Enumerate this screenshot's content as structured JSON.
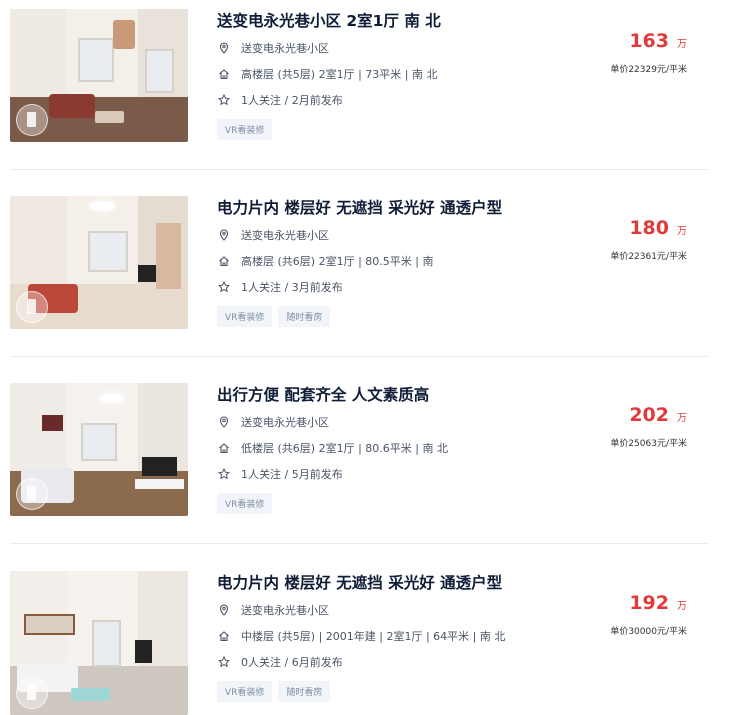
{
  "listings": [
    {
      "title": "送变电永光巷小区 2室1厅 南 北",
      "community": "送变电永光巷小区",
      "info": "高楼层 (共5层) 2室1厅 | 73平米 | 南 北",
      "follow": "1人关注 / 2月前发布",
      "tags": [
        "VR看装修"
      ],
      "price": "163",
      "price_unit": "万",
      "unit_price": "单价22329元/平米"
    },
    {
      "title": "电力片内 楼层好 无遮挡 采光好 通透户型",
      "community": "送变电永光巷小区",
      "info": "高楼层 (共6层) 2室1厅 | 80.5平米 | 南",
      "follow": "1人关注 / 3月前发布",
      "tags": [
        "VR看装修",
        "随时看房"
      ],
      "price": "180",
      "price_unit": "万",
      "unit_price": "单价22361元/平米"
    },
    {
      "title": "出行方便 配套齐全 人文素质高",
      "community": "送变电永光巷小区",
      "info": "低楼层 (共6层) 2室1厅 | 80.6平米 | 南 北",
      "follow": "1人关注 / 5月前发布",
      "tags": [
        "VR看装修"
      ],
      "price": "202",
      "price_unit": "万",
      "unit_price": "单价25063元/平米"
    },
    {
      "title": "电力片内 楼层好 无遮挡 采光好 通透户型",
      "community": "送变电永光巷小区",
      "info": "中楼层 (共5层) | 2001年建 | 2室1厅 | 64平米 | 南 北",
      "follow": "0人关注 / 6月前发布",
      "tags": [
        "VR看装修",
        "随时看房"
      ],
      "price": "192",
      "price_unit": "万",
      "unit_price": "单价30000元/平米"
    }
  ],
  "icons": {
    "community": "location-pin-icon",
    "info": "house-icon",
    "follow": "star-icon",
    "vr": "vr-badge-icon"
  },
  "colors": {
    "price": "#e03a3a",
    "title": "#101d37",
    "tag_bg": "#f1f4f8",
    "tag_text": "#8090a6"
  }
}
